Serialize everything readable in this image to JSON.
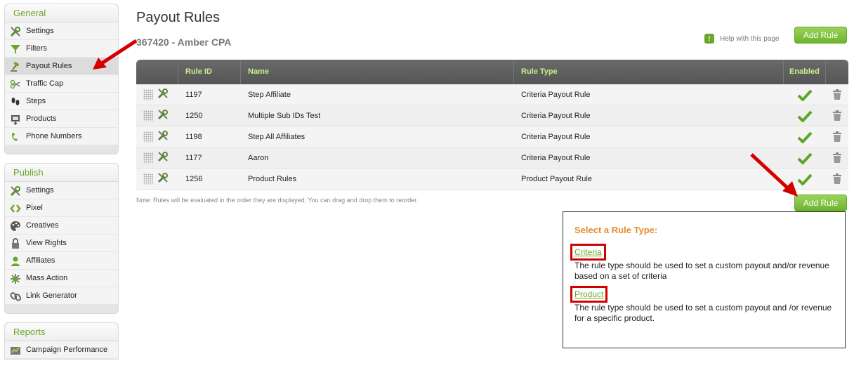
{
  "sidebar": {
    "general": {
      "title": "General",
      "items": [
        {
          "label": "Settings",
          "icon": "tools-icon"
        },
        {
          "label": "Filters",
          "icon": "filter-icon"
        },
        {
          "label": "Payout Rules",
          "icon": "gavel-icon",
          "active": true
        },
        {
          "label": "Traffic Cap",
          "icon": "scissors-icon"
        },
        {
          "label": "Steps",
          "icon": "footprints-icon"
        },
        {
          "label": "Products",
          "icon": "products-icon"
        },
        {
          "label": "Phone Numbers",
          "icon": "phone-icon"
        }
      ]
    },
    "publish": {
      "title": "Publish",
      "items": [
        {
          "label": "Settings",
          "icon": "tools-icon"
        },
        {
          "label": "Pixel",
          "icon": "code-icon"
        },
        {
          "label": "Creatives",
          "icon": "palette-icon"
        },
        {
          "label": "View Rights",
          "icon": "lock-icon"
        },
        {
          "label": "Affiliates",
          "icon": "user-icon"
        },
        {
          "label": "Mass Action",
          "icon": "mass-action-icon"
        },
        {
          "label": "Link Generator",
          "icon": "link-icon"
        }
      ]
    },
    "reports": {
      "title": "Reports",
      "items": [
        {
          "label": "Campaign Performance",
          "icon": "chart-icon"
        }
      ]
    }
  },
  "page": {
    "title": "Payout Rules",
    "subtitle": "367420 - Amber CPA",
    "help_label": "Help with this page",
    "add_rule_label": "Add Rule",
    "note": "Note: Rules will be evaluated in the order they are displayed. You can drag and drop them to reorder."
  },
  "table": {
    "columns": [
      "",
      "Rule ID",
      "Name",
      "Rule Type",
      "Enabled",
      ""
    ],
    "rows": [
      {
        "id": "1197",
        "name": "Step Affiliate",
        "type": "Criteria Payout Rule",
        "enabled": true
      },
      {
        "id": "1250",
        "name": "Multiple Sub IDs Test",
        "type": "Criteria Payout Rule",
        "enabled": true
      },
      {
        "id": "1198",
        "name": "Step All Affiliates",
        "type": "Criteria Payout Rule",
        "enabled": true
      },
      {
        "id": "1177",
        "name": "Aaron",
        "type": "Criteria Payout Rule",
        "enabled": true
      },
      {
        "id": "1256",
        "name": "Product Rules",
        "type": "Product Payout Rule",
        "enabled": true
      }
    ]
  },
  "popup": {
    "title": "Select a Rule Type:",
    "options": [
      {
        "label": "Criteria",
        "description": "The rule type should be used to set a custom payout and/or revenue based on a set of criteria"
      },
      {
        "label": "Product",
        "description": "The rule type should be used to set a custom payout and /or revenue for a specific product."
      }
    ]
  },
  "colors": {
    "accent_green": "#6aa62c",
    "header_text": "#c8f08c",
    "popup_title": "#e88a2a",
    "annotation_red": "#d40000"
  }
}
